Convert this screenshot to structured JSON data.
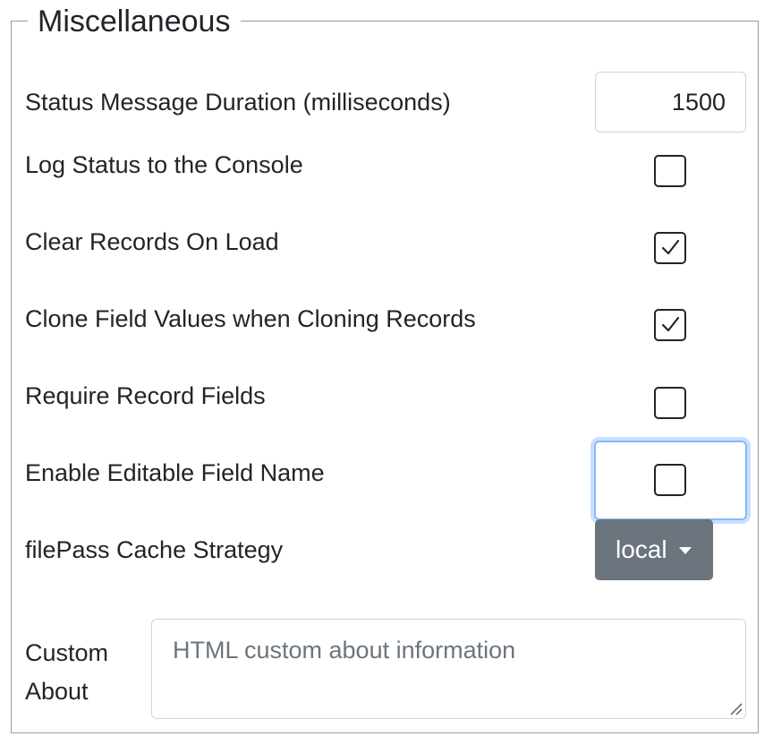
{
  "legend": "Miscellaneous",
  "status_duration": {
    "label": "Status Message Duration (milliseconds)",
    "value": "1500"
  },
  "log_status": {
    "label": "Log Status to the Console",
    "checked": false
  },
  "clear_records": {
    "label": "Clear Records On Load",
    "checked": true
  },
  "clone_field_values": {
    "label": "Clone Field Values when Cloning Records",
    "checked": true
  },
  "require_fields": {
    "label": "Require Record Fields",
    "checked": false
  },
  "editable_field_name": {
    "label": "Enable Editable Field Name",
    "checked": false
  },
  "cache_strategy": {
    "label": "filePass Cache Strategy",
    "value": "local"
  },
  "custom_about": {
    "label_line1": "Custom",
    "label_line2": "About",
    "placeholder": "HTML custom about information"
  },
  "colors": {
    "dropdown_bg": "#6c757d",
    "focus_ring": "#86b7fe",
    "text": "#212529",
    "placeholder": "#6c757d"
  }
}
